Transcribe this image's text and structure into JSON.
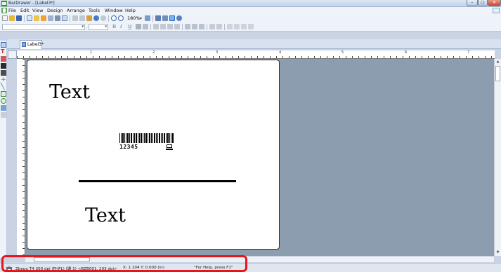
{
  "window": {
    "title": "BarDrawer - [Label3*]",
    "controls": {
      "minimize": "–",
      "maximize": "□",
      "close": "✕"
    }
  },
  "menubar": {
    "items": [
      "File",
      "Edit",
      "View",
      "Design",
      "Arrange",
      "Tools",
      "Window",
      "Help"
    ]
  },
  "toolbar": {
    "zoom": "180%",
    "format_buttons": {
      "bold": "B",
      "italic": "I",
      "underline": "U"
    }
  },
  "tabs": [
    {
      "label": "Label3*"
    }
  ],
  "ruler": {
    "h_numbers": [
      "1",
      "2",
      "3",
      "4",
      "5",
      "6",
      "7"
    ]
  },
  "canvas": {
    "text_top": "Text",
    "text_bottom": "Text",
    "barcode_digits": "12345"
  },
  "statusbar": {
    "printer": "Zbepu T4 300 dpi (PHPL) (端 1) <BZB001, 203 dpi>",
    "coords": "X: 1.104  Y: 0.000 (in)",
    "help": "\"For Help, press F1\""
  },
  "colors": {
    "workspace": "#8d9db0",
    "highlight": "#e8141b"
  }
}
